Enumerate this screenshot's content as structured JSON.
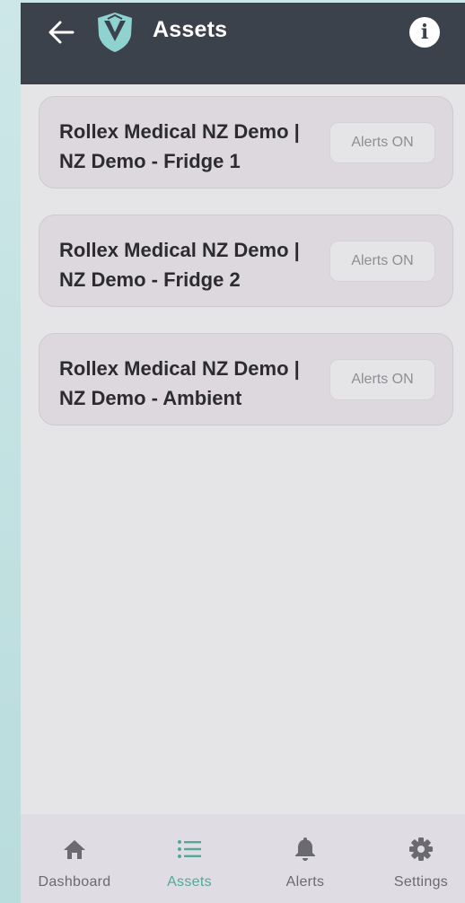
{
  "header": {
    "title": "Assets",
    "back_icon": "arrow-left-icon",
    "logo_icon": "shield-v-logo",
    "info_icon": "info-icon",
    "info_glyph": "i"
  },
  "assets": [
    {
      "title_line1": "Rollex Medical NZ Demo |",
      "title_line2": "NZ Demo - Fridge 1",
      "alert_label": "Alerts ON"
    },
    {
      "title_line1": "Rollex Medical NZ Demo |",
      "title_line2": "NZ Demo - Fridge 2",
      "alert_label": "Alerts ON"
    },
    {
      "title_line1": "Rollex Medical NZ Demo |",
      "title_line2": "NZ Demo - Ambient",
      "alert_label": "Alerts ON"
    }
  ],
  "tabs": [
    {
      "label": "Dashboard",
      "icon": "home-icon",
      "active": false
    },
    {
      "label": "Assets",
      "icon": "list-icon",
      "active": true
    },
    {
      "label": "Alerts",
      "icon": "bell-icon",
      "active": false
    },
    {
      "label": "Settings",
      "icon": "gear-icon",
      "active": false
    }
  ],
  "colors": {
    "header_bg": "#3c424b",
    "accent": "#53a89a",
    "logo": "#8fd3d1",
    "card_bg": "#ddd8de",
    "page_bg": "#e5e5e8"
  }
}
